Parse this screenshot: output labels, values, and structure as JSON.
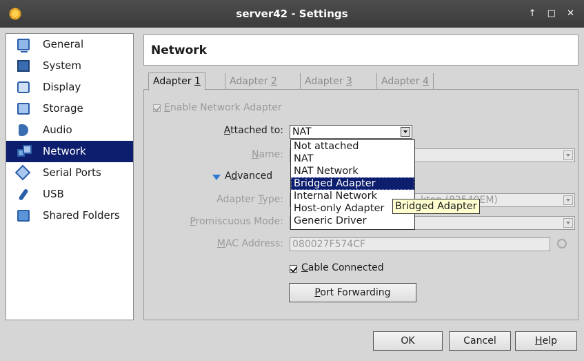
{
  "window": {
    "title": "server42 - Settings",
    "controls": "↑ □ ✕"
  },
  "sidebar": {
    "items": [
      {
        "label": "General",
        "icon": "monitor-icon"
      },
      {
        "label": "System",
        "icon": "chip-icon"
      },
      {
        "label": "Display",
        "icon": "display-icon"
      },
      {
        "label": "Storage",
        "icon": "storage-icon"
      },
      {
        "label": "Audio",
        "icon": "audio-icon"
      },
      {
        "label": "Network",
        "icon": "network-icon",
        "selected": true
      },
      {
        "label": "Serial Ports",
        "icon": "serial-port-icon"
      },
      {
        "label": "USB",
        "icon": "usb-icon"
      },
      {
        "label": "Shared Folders",
        "icon": "folder-icon"
      }
    ]
  },
  "page": {
    "title": "Network"
  },
  "tabs": [
    {
      "label": "Adapter ",
      "num": "1",
      "active": true
    },
    {
      "label": "Adapter ",
      "num": "2"
    },
    {
      "label": "Adapter ",
      "num": "3"
    },
    {
      "label": "Adapter ",
      "num": "4"
    }
  ],
  "form": {
    "enable_adapter_label_rest": "nable Network Adapter",
    "enable_adapter_mnemonic": "E",
    "attached_to_label_mnemonic": "A",
    "attached_to_label_rest": "ttached to:",
    "attached_to_value": "NAT",
    "name_label_mnemonic": "N",
    "name_label_rest": "ame:",
    "advanced_label_pre": "A",
    "advanced_label_mnemonic": "d",
    "advanced_label_rest": "vanced",
    "adapter_type_label_pre": "Adapter ",
    "adapter_type_label_mnemonic": "T",
    "adapter_type_label_rest": "ype:",
    "adapter_type_value": "ktop (82540EM)",
    "promiscuous_label_mnemonic": "P",
    "promiscuous_label_rest": "romiscuous Mode:",
    "mac_label_pre": "",
    "mac_label_mnemonic": "M",
    "mac_label_rest": "AC Address:",
    "mac_value": "080027F574CF",
    "cable_label_mnemonic": "C",
    "cable_label_rest": "able Connected",
    "port_forwarding_mnemonic": "P",
    "port_forwarding_rest": "ort Forwarding"
  },
  "dropdown": {
    "options": [
      "Not attached",
      "NAT",
      "NAT Network",
      "Bridged Adapter",
      "Internal Network",
      "Host-only Adapter",
      "Generic Driver"
    ],
    "highlighted": "Bridged Adapter"
  },
  "tooltip": {
    "text": "Bridged Adapter"
  },
  "footer": {
    "ok": "OK",
    "cancel": "Cancel",
    "help_mnemonic": "H",
    "help_rest": "elp"
  }
}
